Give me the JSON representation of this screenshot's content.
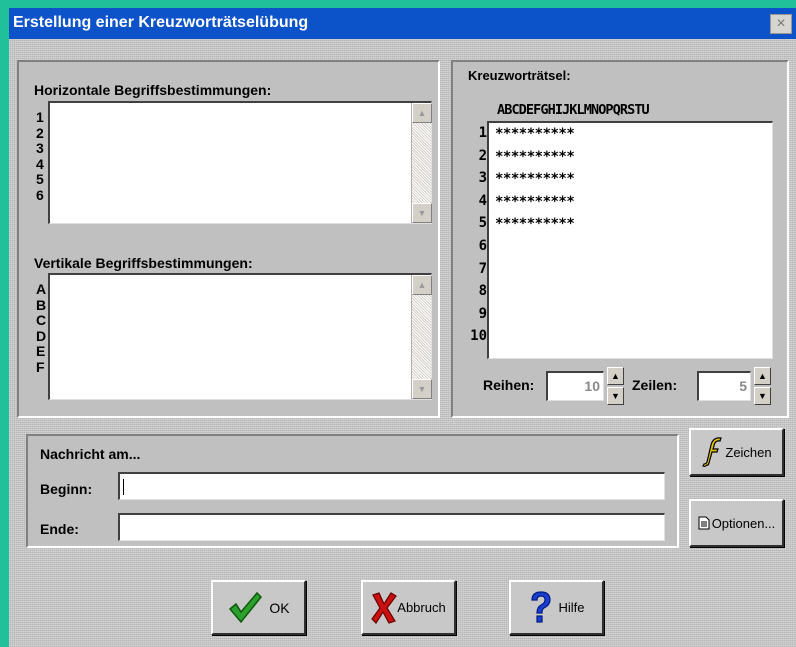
{
  "window": {
    "title": "Erstellung einer Kreuzworträtselübung",
    "close_glyph": "×"
  },
  "horizontal": {
    "label": "Horizontale Begriffsbestimmungen:",
    "rows": [
      "1",
      "2",
      "3",
      "4",
      "5",
      "6"
    ]
  },
  "vertical": {
    "label": "Vertikale Begriffsbestimmungen:",
    "rows": [
      "A",
      "B",
      "C",
      "D",
      "E",
      "F"
    ]
  },
  "crossword": {
    "label": "Kreuzworträtsel:",
    "columns": "ABCDEFGHIJKLMNOPQRSTU",
    "row_numbers": [
      "1",
      "2",
      "3",
      "4",
      "5",
      "6",
      "7",
      "8",
      "9",
      "10"
    ],
    "grid_rows": [
      "**********",
      "**********",
      "**********",
      "**********",
      "**********",
      "",
      "",
      "",
      "",
      ""
    ]
  },
  "reihen": {
    "label": "Reihen:",
    "value": "10"
  },
  "zeilen": {
    "label": "Zeilen:",
    "value": "5"
  },
  "message": {
    "label": "Nachricht am...",
    "begin_label": "Beginn:",
    "begin_value": "",
    "end_label": "Ende:",
    "end_value": ""
  },
  "buttons": {
    "zeichen": "Zeichen",
    "optionen": "Optionen...",
    "ok": "OK",
    "abbruch": "Abbruch",
    "hilfe": "Hilfe"
  },
  "icons": {
    "zeichen": "font-f-icon",
    "optionen": "document-icon",
    "ok": "checkmark-icon",
    "abbruch": "red-x-icon",
    "hilfe": "question-mark-icon"
  },
  "colors": {
    "titlebar": "#0c52c9",
    "desktop": "#1fc09a",
    "dialog": "#c8c8c8",
    "ok_check": "#2ca02c",
    "abbruch_x": "#cc1010",
    "hilfe_q": "#1a3fd0"
  }
}
